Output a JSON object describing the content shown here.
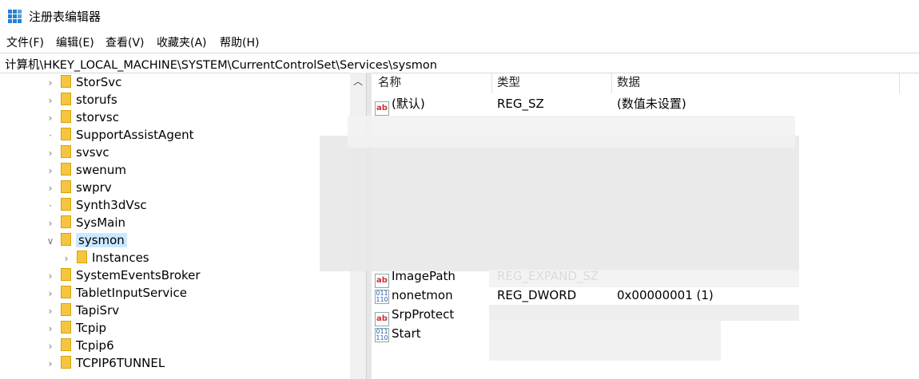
{
  "window": {
    "title": "注册表编辑器"
  },
  "menu": [
    "文件(F)",
    "编辑(E)",
    "查看(V)",
    "收藏夹(A)",
    "帮助(H)"
  ],
  "address": "计算机\\HKEY_LOCAL_MACHINE\\SYSTEM\\CurrentControlSet\\Services\\sysmon",
  "tree": [
    {
      "label": "StorSvc",
      "expandable": true
    },
    {
      "label": "storufs",
      "expandable": true
    },
    {
      "label": "storvsc",
      "expandable": true
    },
    {
      "label": "SupportAssistAgent",
      "expandable": false
    },
    {
      "label": "svsvc",
      "expandable": true
    },
    {
      "label": "swenum",
      "expandable": true
    },
    {
      "label": "swprv",
      "expandable": true
    },
    {
      "label": "Synth3dVsc",
      "expandable": false
    },
    {
      "label": "SysMain",
      "expandable": true
    },
    {
      "label": "sysmon",
      "expandable": true,
      "expanded": true,
      "selected": true
    },
    {
      "label": "Instances",
      "expandable": true,
      "child": true
    },
    {
      "label": "SystemEventsBroker",
      "expandable": true
    },
    {
      "label": "TabletInputService",
      "expandable": true
    },
    {
      "label": "TapiSrv",
      "expandable": true
    },
    {
      "label": "Tcpip",
      "expandable": true
    },
    {
      "label": "Tcpip6",
      "expandable": true
    },
    {
      "label": "TCPIP6TUNNEL",
      "expandable": true
    }
  ],
  "columns": {
    "name": "名称",
    "type": "类型",
    "data": "数据"
  },
  "values": [
    {
      "name": "(默认)",
      "type": "REG_SZ",
      "data": "(数值未设置)",
      "kind": "sz"
    },
    {
      "name": "ImagePath",
      "type": "REG_EXPAND_SZ",
      "data": "",
      "kind": "sz"
    },
    {
      "name": "nonetmon",
      "type": "REG_DWORD",
      "data": "0x00000001 (1)",
      "kind": "bin"
    },
    {
      "name": "SrpProtect",
      "type": "",
      "data": "",
      "kind": "sz"
    },
    {
      "name": "Start",
      "type": "",
      "data": "",
      "kind": "bin"
    }
  ]
}
